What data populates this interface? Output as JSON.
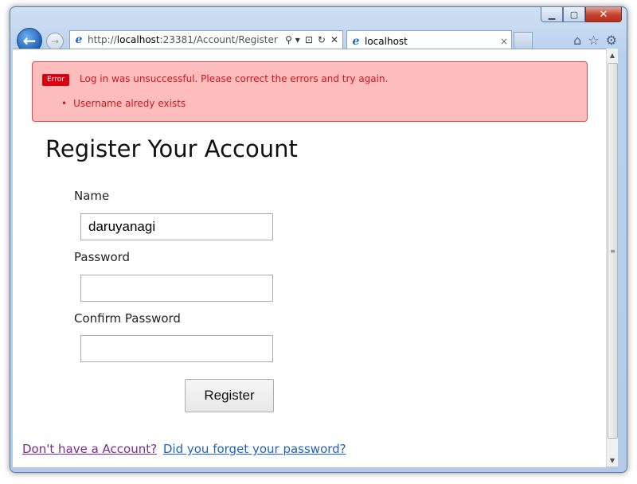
{
  "window": {
    "controls": {
      "minimize": "▁",
      "maximize": "▢",
      "close": "✕"
    }
  },
  "nav": {
    "back_icon": "←",
    "forward_icon": "→",
    "address": {
      "prefix": "http://",
      "host": "localhost",
      "path": ":23381/Account/Register"
    },
    "address_tools": [
      "⚲ ▾",
      "⊡",
      "↻",
      "✕"
    ],
    "tab": {
      "title": "localhost",
      "close": "×"
    },
    "toolbar_icons": [
      "⌂",
      "☆",
      "⚙"
    ]
  },
  "alert": {
    "badge": "Error",
    "message": "Log in was unsuccessful. Please correct the errors and try again.",
    "errors": [
      "Username alredy exists"
    ],
    "colors": {
      "background": "#fdbdbd",
      "text": "#d4141b",
      "badge": "#d9000f"
    }
  },
  "form": {
    "title": "Register Your Account",
    "name_label": "Name",
    "name_value": "daruyanagi",
    "password_label": "Password",
    "password_value": "",
    "confirm_label": "Confirm Password",
    "confirm_value": "",
    "submit_label": "Register"
  },
  "footer": {
    "no_account": "Don't have a Account?",
    "forgot_password": "Did you forget your password?"
  },
  "scrollbar": {
    "up": "▲",
    "down": "▼",
    "grip": "≡"
  }
}
